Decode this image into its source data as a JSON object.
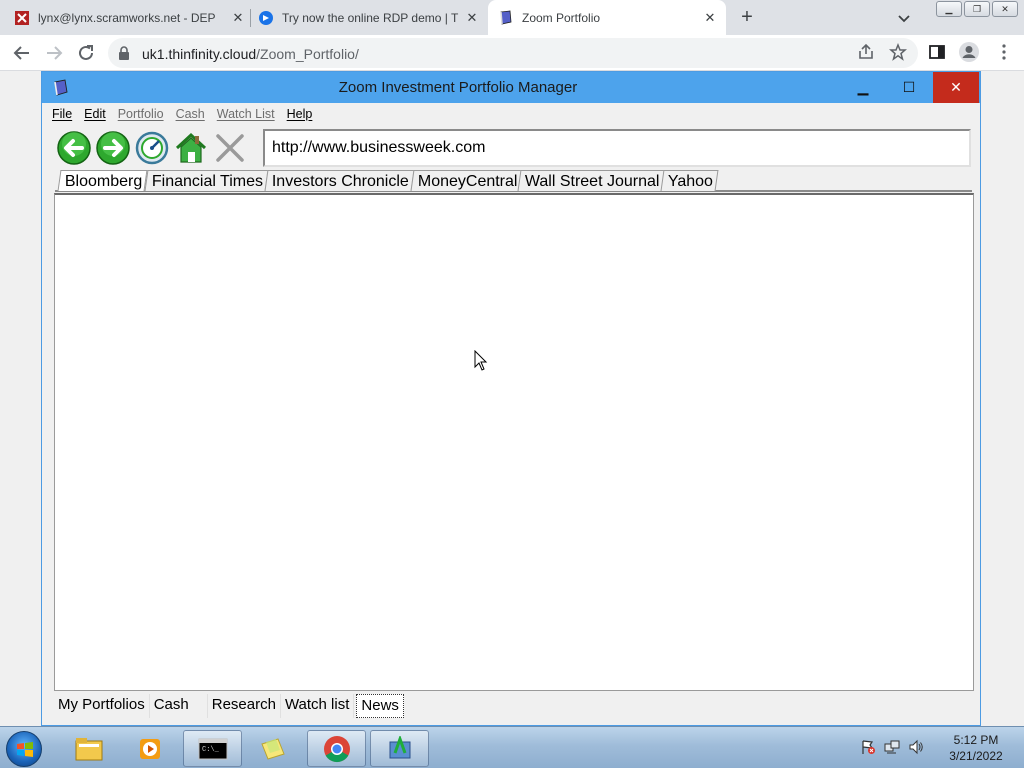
{
  "browser": {
    "tabs": [
      {
        "title": "lynx@lynx.scramworks.net - DEP",
        "icon": "terminal-red-icon",
        "active": false
      },
      {
        "title": "Try now the online RDP demo | T",
        "icon": "thinfinity-icon",
        "active": false
      },
      {
        "title": "Zoom Portfolio",
        "icon": "book-icon",
        "active": true
      }
    ],
    "url_host": "uk1.thinfinity.cloud",
    "url_path": "/Zoom_Portfolio/"
  },
  "app": {
    "title": "Zoom Investment Portfolio Manager",
    "close_glyph": "✕",
    "menu": [
      {
        "label": "File",
        "enabled": true
      },
      {
        "label": "Edit",
        "enabled": true
      },
      {
        "label": "Portfolio",
        "enabled": false
      },
      {
        "label": "Cash",
        "enabled": false
      },
      {
        "label": "Watch List",
        "enabled": false
      },
      {
        "label": "Help",
        "enabled": true
      }
    ],
    "address": "http://www.businessweek.com",
    "site_tabs": [
      "Bloomberg",
      "Financial Times",
      "Investors Chronicle",
      "MoneyCentral",
      "Wall Street Journal",
      "Yahoo"
    ],
    "active_site_tab": "Bloomberg",
    "bottom_tabs": [
      "My Portfolios",
      "Cash",
      "Research",
      "Watch list",
      "News"
    ],
    "active_bottom_tab": "News"
  },
  "taskbar": {
    "time": "5:12 PM",
    "date": "3/21/2022",
    "items": [
      "explorer-folder-icon",
      "media-player-icon",
      "cmd-icon",
      "sticky-notes-icon",
      "chrome-icon",
      "portfolio-app-icon"
    ]
  },
  "colors": {
    "title_bar": "#4da3ec",
    "close_button": "#c42b1c",
    "chrome_frame": "#dee1e6"
  }
}
